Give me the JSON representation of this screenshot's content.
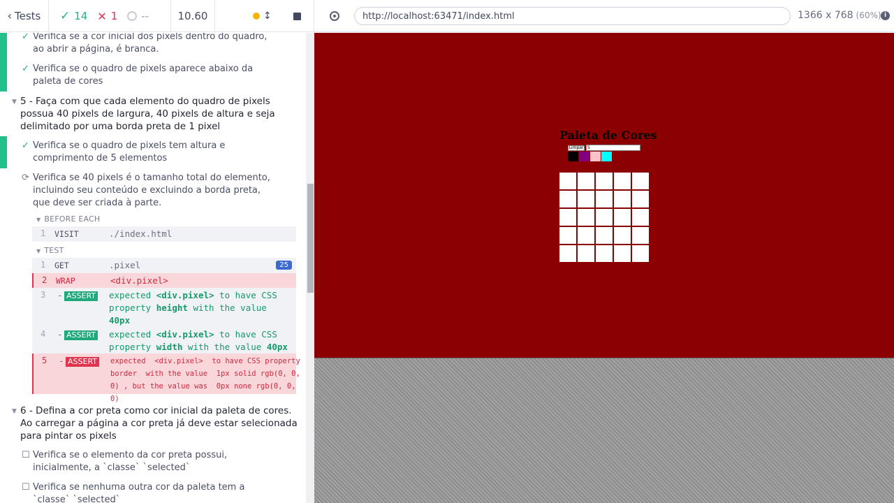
{
  "header": {
    "tests_label": "Tests",
    "passed": "14",
    "failed": "1",
    "pending": "--",
    "duration": "10.60",
    "url": "http://localhost:63471/index.html",
    "viewport_size": "1366 x 768",
    "viewport_scale": "(60%)",
    "info_icon": "i"
  },
  "reporter": {
    "tests_top": [
      {
        "title": "Verifica se a cor inicial dos pixels dentro do quadro, ao abrir a página, é branca.",
        "state": "passed"
      },
      {
        "title": "Verifica se o quadro de pixels aparece abaixo da paleta de cores",
        "state": "passed"
      }
    ],
    "suite5": "5 - Faça com que cada elemento do quadro de pixels possua 40 pixels de largura, 40 pixels de altura e seja delimitado por uma borda preta de 1 pixel",
    "suite5_tests": [
      {
        "title": "Verifica se o quadro de pixels tem altura e comprimento de 5 elementos",
        "state": "passed"
      },
      {
        "title": "Verifica se 40 pixels é o tamanho total do elemento, incluindo seu conteúdo e excluindo a borda preta, que deve ser criada à parte.",
        "state": "running"
      }
    ],
    "before_each_label": "BEFORE EACH",
    "test_label": "TEST",
    "commands": [
      {
        "num": "1",
        "name": "VISIT",
        "message": "./index.html"
      },
      {
        "num": "1",
        "name": "GET",
        "message": ".pixel",
        "badge": "25"
      },
      {
        "num": "2",
        "name": "WRAP",
        "message": "<div.pixel>"
      },
      {
        "num": "3",
        "name": "ASSERT",
        "dash": "-",
        "m1": "expected",
        "m2": "<div.pixel>",
        "m3": "to have CSS",
        "m4": "property",
        "m5": "height",
        "m6": "with the value",
        "m7": "40px"
      },
      {
        "num": "4",
        "name": "ASSERT",
        "dash": "-",
        "m1": "expected",
        "m2": "<div.pixel>",
        "m3": "to have CSS",
        "m4": "property",
        "m5": "width",
        "m6": "with the value",
        "m7": "40px"
      },
      {
        "num": "5",
        "name": "ASSERT",
        "dash": "-",
        "l1": "expected  <div.pixel>  to have CSS property",
        "l2": "border  with the value  1px solid rgb(0, 0,",
        "l3": "0) , but the value was  0px none rgb(0, 0,",
        "l4": "0)"
      }
    ],
    "suite6": "6 - Defina a cor preta como cor inicial da paleta de cores. Ao carregar a página a cor preta já deve estar selecionada para pintar os pixels",
    "suite6_tests": [
      {
        "title": "Verifica se o elemento da cor preta possui, inicialmente, a `classe` `selected`",
        "state": "pending"
      },
      {
        "title": "Verifica se nenhuma outra cor da paleta tem a `classe` `selected`",
        "state": "pending"
      }
    ]
  },
  "app": {
    "title": "Paleta de Cores",
    "clear_button": "Limpar",
    "size_value": "5",
    "palette_colors": [
      "#000000",
      "#800080",
      "#ffc0cb",
      "#00ffff"
    ],
    "background_color": "#8b0000"
  }
}
